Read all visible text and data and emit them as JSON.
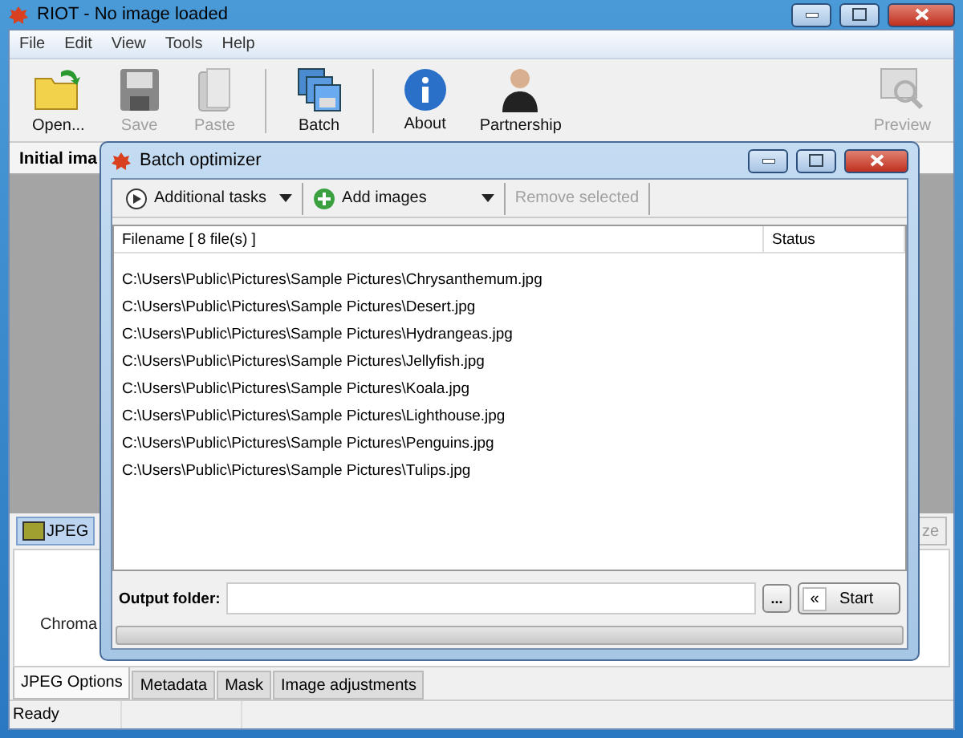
{
  "window": {
    "title": "RIOT - No image loaded"
  },
  "menu": [
    "File",
    "Edit",
    "View",
    "Tools",
    "Help"
  ],
  "toolbar": [
    {
      "label": "Open...",
      "kind": "open",
      "disabled": false,
      "separator_before": false
    },
    {
      "label": "Save",
      "kind": "save",
      "disabled": true,
      "separator_before": false
    },
    {
      "label": "Paste",
      "kind": "paste",
      "disabled": true,
      "separator_before": false
    },
    {
      "label": "Batch",
      "kind": "batch",
      "disabled": false,
      "separator_before": true
    },
    {
      "label": "About",
      "kind": "about",
      "disabled": false,
      "separator_before": true
    },
    {
      "label": "Partnership",
      "kind": "partner",
      "disabled": false,
      "separator_before": false
    },
    {
      "label": "Preview",
      "kind": "preview",
      "disabled": true,
      "separator_before": false
    }
  ],
  "initial_image": {
    "label": "Initial ima"
  },
  "format_buttons": [
    {
      "label": "JPEG",
      "selected": true
    }
  ],
  "options": {
    "chroma_label": "Chroma",
    "cut_button": "ze"
  },
  "bottom_tabs": [
    {
      "label": "JPEG Options",
      "selected": true
    },
    {
      "label": "Metadata",
      "selected": false
    },
    {
      "label": "Mask",
      "selected": false
    },
    {
      "label": "Image adjustments",
      "selected": false
    }
  ],
  "status_bar": [
    "Ready"
  ],
  "dialog": {
    "title": "Batch optimizer",
    "toolbar": [
      {
        "label": "Additional tasks",
        "kind": "play",
        "dropdown": true,
        "disabled": false
      },
      {
        "label": "Add images",
        "kind": "add",
        "dropdown": true,
        "disabled": false
      },
      {
        "label": "Remove selected",
        "kind": "plain",
        "dropdown": false,
        "disabled": true
      }
    ],
    "columns": [
      "Filename [ 8 file(s) ]",
      "Status"
    ],
    "rows": [
      "C:\\Users\\Public\\Pictures\\Sample Pictures\\Chrysanthemum.jpg",
      "C:\\Users\\Public\\Pictures\\Sample Pictures\\Desert.jpg",
      "C:\\Users\\Public\\Pictures\\Sample Pictures\\Hydrangeas.jpg",
      "C:\\Users\\Public\\Pictures\\Sample Pictures\\Jellyfish.jpg",
      "C:\\Users\\Public\\Pictures\\Sample Pictures\\Koala.jpg",
      "C:\\Users\\Public\\Pictures\\Sample Pictures\\Lighthouse.jpg",
      "C:\\Users\\Public\\Pictures\\Sample Pictures\\Penguins.jpg",
      "C:\\Users\\Public\\Pictures\\Sample Pictures\\Tulips.jpg"
    ],
    "output_folder": {
      "label": "Output folder:"
    },
    "browse": "...",
    "start": {
      "arrow": "«",
      "label": "Start"
    },
    "progress": {
      "level": 0
    }
  }
}
